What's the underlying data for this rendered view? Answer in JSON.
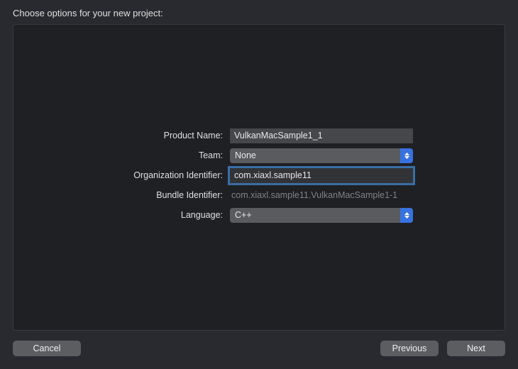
{
  "dialog": {
    "title": "Choose options for your new project:"
  },
  "form": {
    "product_name": {
      "label": "Product Name:",
      "value": "VulkanMacSample1_1"
    },
    "team": {
      "label": "Team:",
      "selected": "None"
    },
    "organization_identifier": {
      "label": "Organization Identifier:",
      "value": "com.xiaxl.sample11"
    },
    "bundle_identifier": {
      "label": "Bundle Identifier:",
      "value": "com.xiaxl.sample11.VulkanMacSample1-1"
    },
    "language": {
      "label": "Language:",
      "selected": "C++"
    }
  },
  "footer": {
    "cancel": "Cancel",
    "previous": "Previous",
    "next": "Next"
  }
}
